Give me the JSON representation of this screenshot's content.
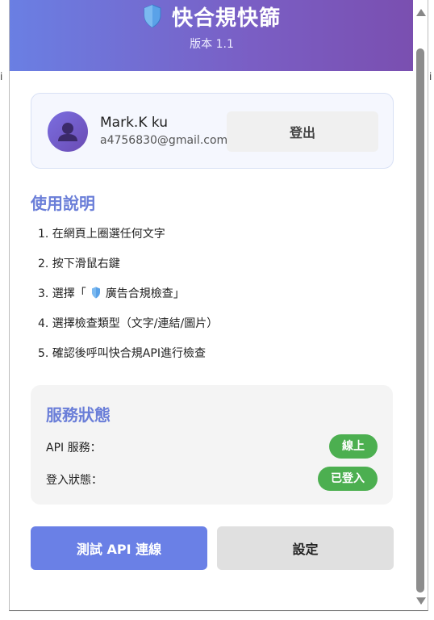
{
  "colors": {
    "header_gradient_start": "#6a7fe3",
    "header_gradient_end": "#7a4fb0",
    "accent_title": "#6a7ed8",
    "status_green": "#4caf50",
    "primary_button": "#6a80e6"
  },
  "header": {
    "icon": "shield-icon",
    "title": "快合規快篩",
    "version": "版本 1.1"
  },
  "user": {
    "avatar_icon": "user-avatar-icon",
    "name": "Mark.K ku",
    "email": "a4756830@gmail.com",
    "logout_label": "登出"
  },
  "instructions": {
    "title": "使用說明",
    "items": [
      "1. 在網頁上圈選任何文字",
      "2. 按下滑鼠右鍵",
      "3. 選擇「",
      "4. 選擇檢查類型（文字/連結/圖片）",
      "5. 確認後呼叫快合規API進行檢查"
    ],
    "item3_suffix": "廣告合規檢查」"
  },
  "status": {
    "title": "服務狀態",
    "rows": [
      {
        "label": "API 服務：",
        "value": "線上"
      },
      {
        "label": "登入狀態：",
        "value": "已登入"
      }
    ]
  },
  "actions": {
    "test_label": "測試 API 連線",
    "settings_label": "設定"
  },
  "background": {
    "left_fragment": "i",
    "right_fragment": "i"
  }
}
